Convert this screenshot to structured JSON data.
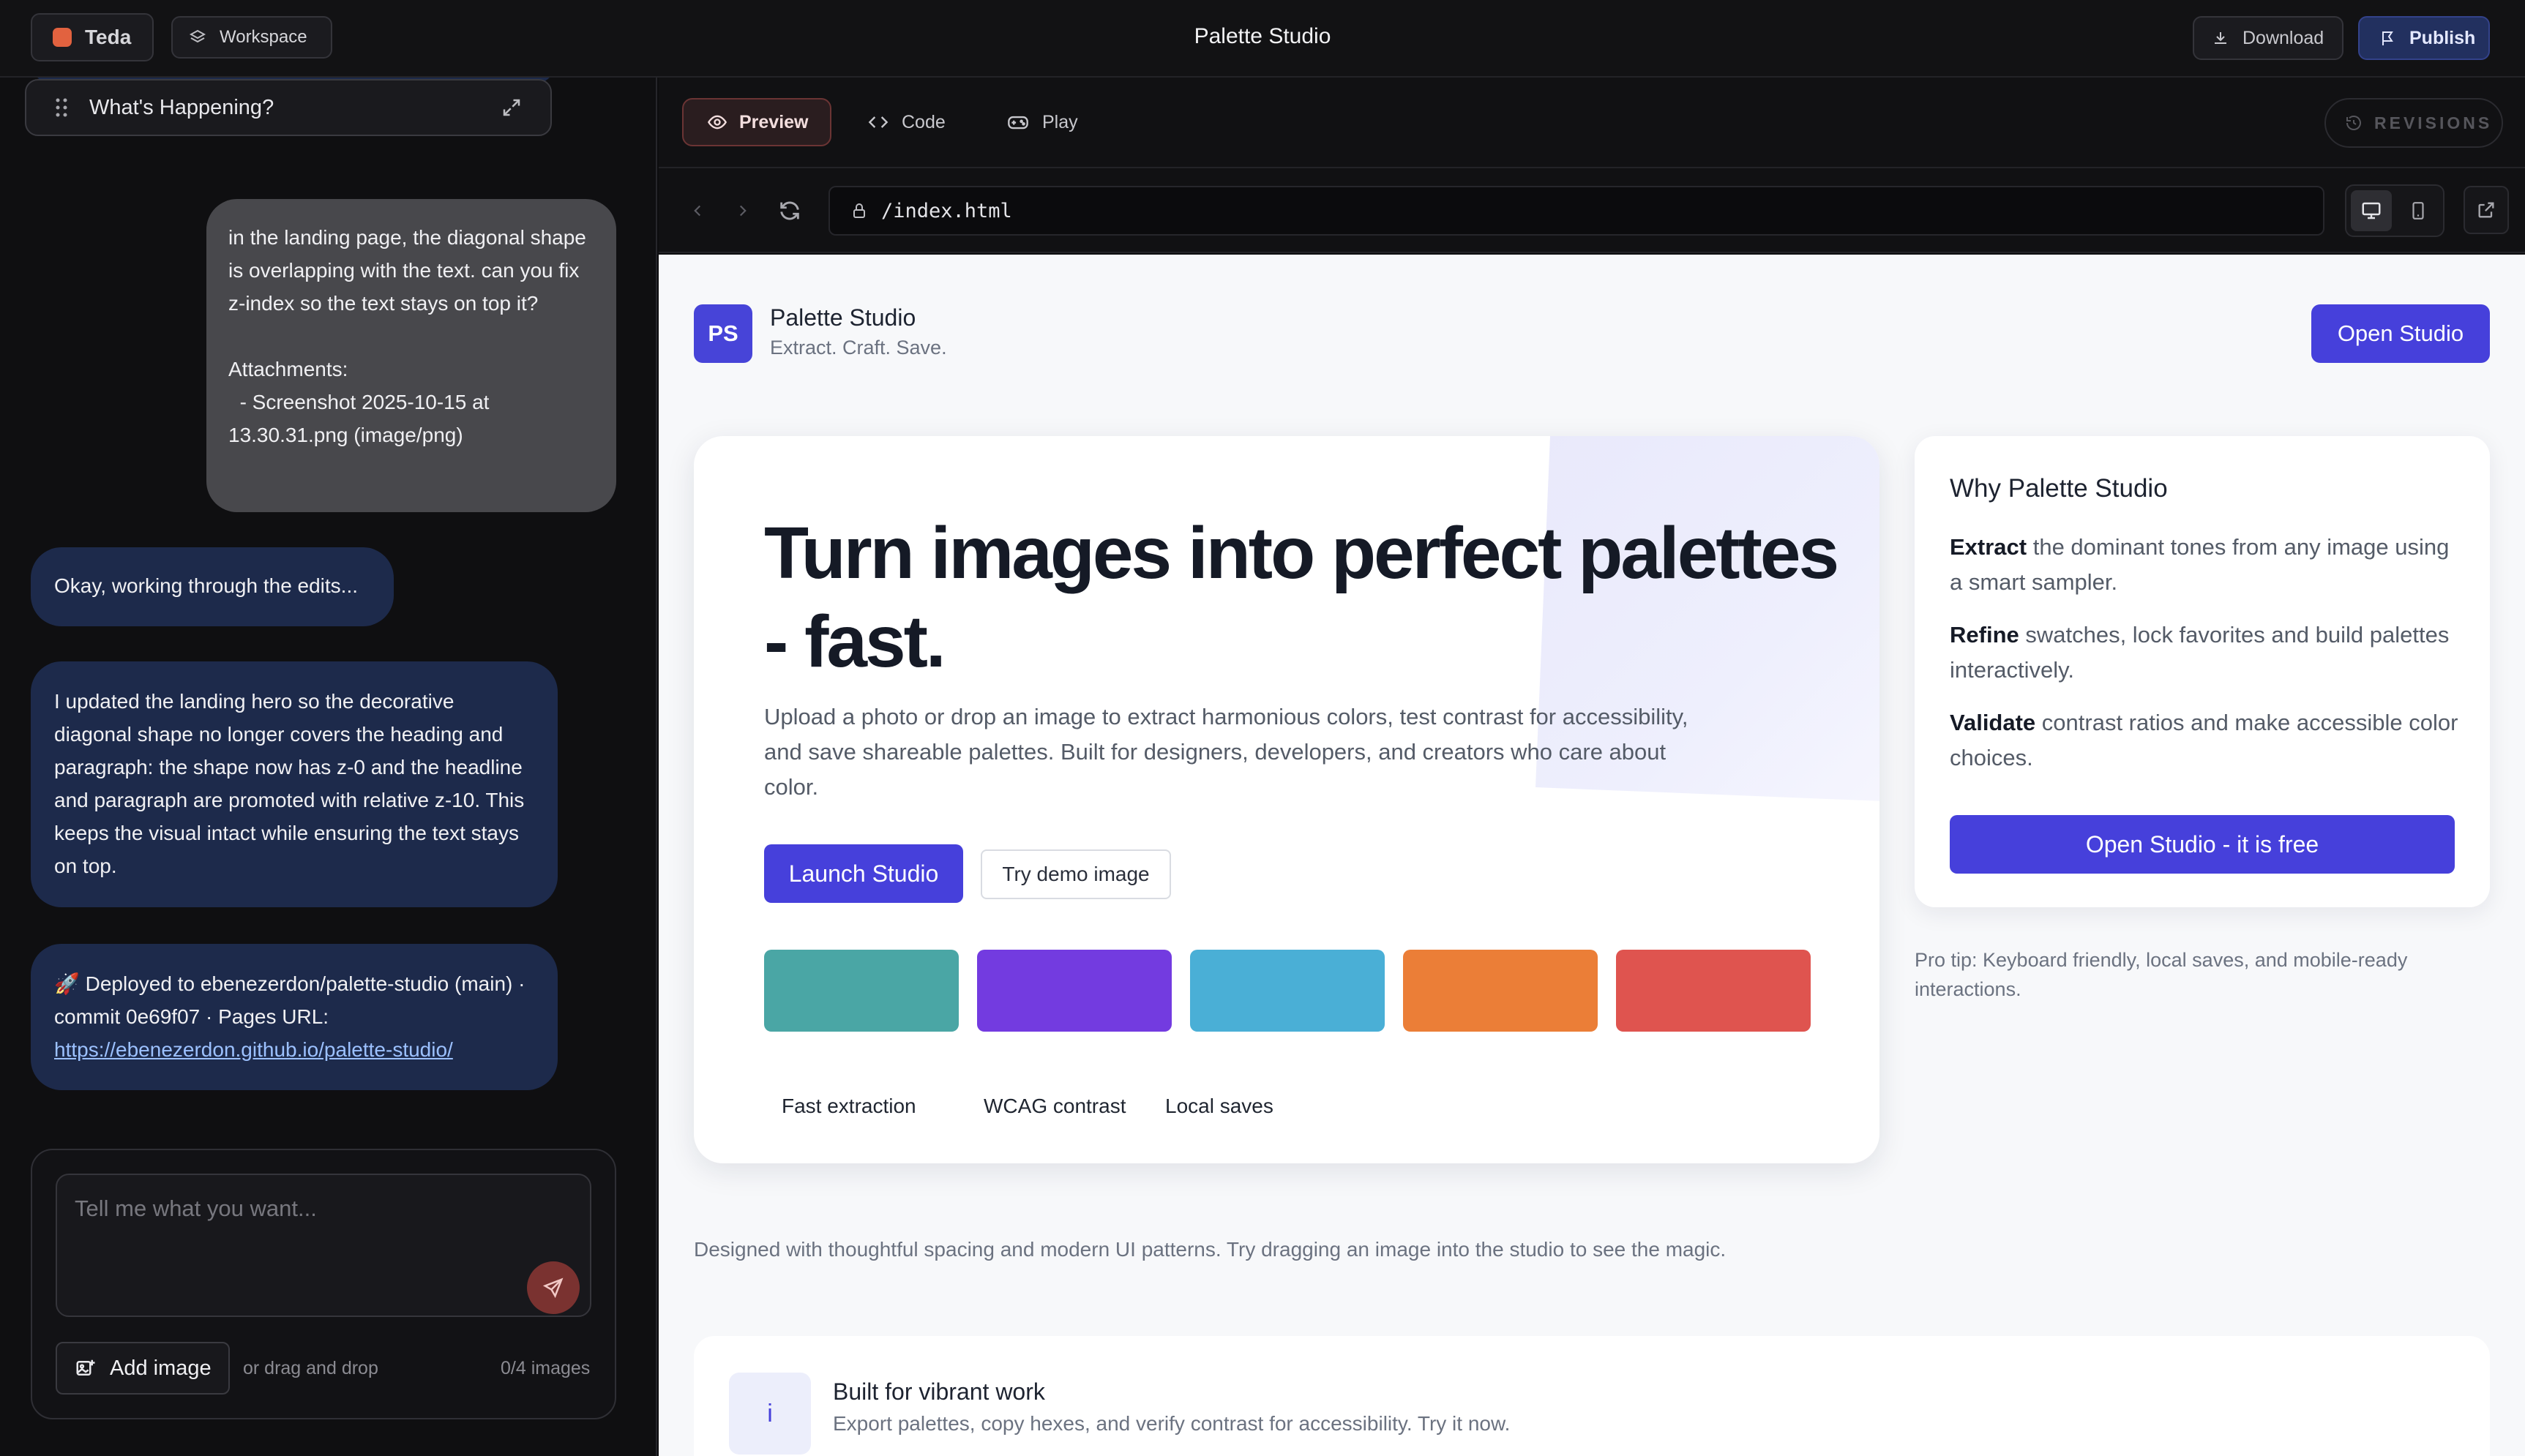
{
  "topbar": {
    "brand_label": "Teda",
    "workspace_label": "Workspace",
    "title": "Palette Studio",
    "download_label": "Download",
    "publish_label": "Publish"
  },
  "chat": {
    "pinned_title": "What's Happening?",
    "user_message": "in the landing page, the diagonal shape is overlapping with the text. can you fix z-index so the text stays on top it?\n\nAttachments:\n  - Screenshot 2025-10-15 at 13.30.31.png (image/png)",
    "ai_status": "Okay, working through the edits...",
    "ai_update": "I updated the landing hero so the decorative diagonal shape no longer covers the heading and paragraph: the shape now has z-0 and the headline and paragraph are promoted with relative z-10. This keeps the visual intact while ensuring the text stays on top.",
    "deploy_text": "🚀 Deployed to ebenezerdon/palette-studio (main) · commit 0e69f07 · Pages URL:",
    "deploy_link": "https://ebenezerdon.github.io/palette-studio/",
    "composer_placeholder": "Tell me what you want...",
    "add_image_label": "Add image",
    "drag_hint": "or drag and drop",
    "image_count": "0/4 images"
  },
  "viewer": {
    "tabs": [
      {
        "label": "Preview",
        "active": true
      },
      {
        "label": "Code",
        "active": false
      },
      {
        "label": "Play",
        "active": false
      }
    ],
    "revisions_label": "REVISIONS",
    "url": "/index.html"
  },
  "site": {
    "logo_initials": "PS",
    "brand_name": "Palette Studio",
    "tagline": "Extract. Craft. Save.",
    "open_studio_label": "Open Studio",
    "hero_title": "Turn images into perfect palettes - fast.",
    "hero_description": "Upload a photo or drop an image to extract harmonious colors, test contrast for accessibility, and save shareable palettes. Built for designers, developers, and creators who care about color.",
    "launch_label": "Launch Studio",
    "demo_label": "Try demo image",
    "swatches": [
      "#4aa6a5",
      "#733be0",
      "#4aafd6",
      "#eb7e37",
      "#df544f"
    ],
    "features": [
      "Fast extraction",
      "WCAG contrast",
      "Local saves"
    ],
    "why_title": "Why Palette Studio",
    "why_items": [
      {
        "bold": "Extract",
        "text": " the dominant tones from any image using a smart sampler."
      },
      {
        "bold": "Refine",
        "text": " swatches, lock favorites and build palettes interactively."
      },
      {
        "bold": "Validate",
        "text": " contrast ratios and make accessible color choices."
      }
    ],
    "why_cta": "Open Studio - it is free",
    "pro_tip": "Pro tip: Keyboard friendly, local saves, and mobile-ready interactions.",
    "footer_note": "Designed with thoughtful spacing and modern UI patterns. Try dragging an image into the studio to see the magic.",
    "built_icon": "i",
    "built_title": "Built for vibrant work",
    "built_sub": "Export palettes, copy hexes, and verify contrast for accessibility. Try it now."
  },
  "colors": {
    "accent": "#4640db",
    "chat_ai_bubble": "#1d2a4b",
    "chat_user_bubble": "#48484c"
  },
  "icons": [
    "layers-icon",
    "download-icon",
    "publish-icon",
    "drag-handle-icon",
    "expand-icon",
    "send-icon",
    "image-add-icon",
    "eye-icon",
    "code-icon",
    "gamepad-icon",
    "history-icon",
    "back-icon",
    "forward-icon",
    "reload-icon",
    "lock-icon",
    "desktop-icon",
    "mobile-icon",
    "external-link-icon"
  ]
}
